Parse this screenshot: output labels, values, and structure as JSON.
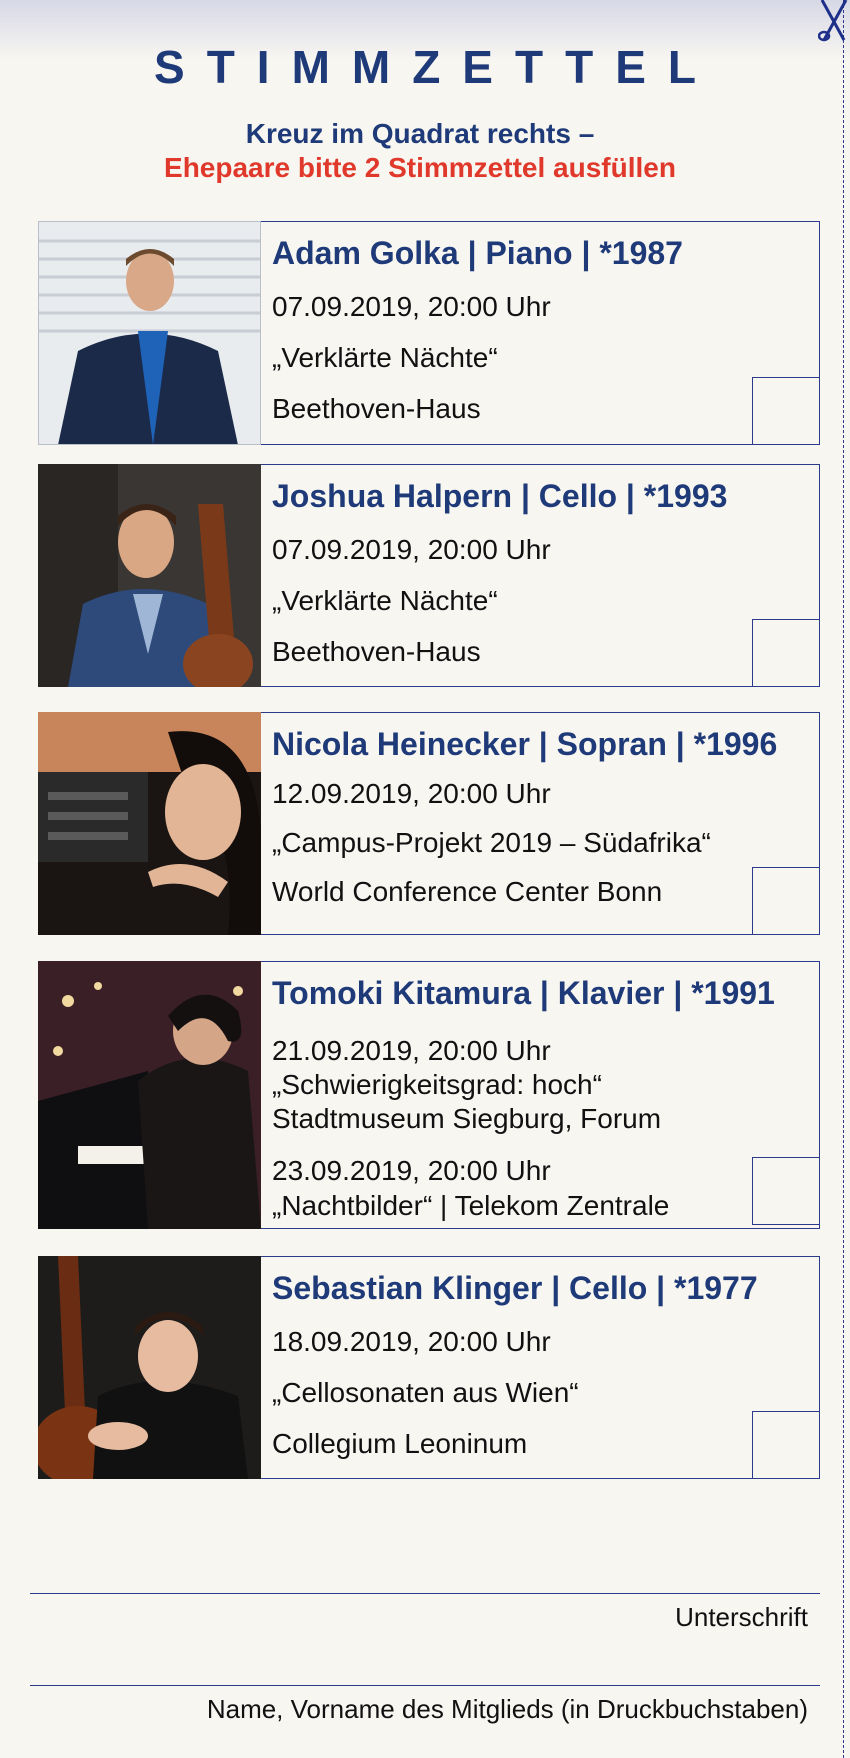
{
  "title": "STIMMZETTEL",
  "subtitle_line1": "Kreuz im Quadrat rechts –",
  "subtitle_line2": "Ehepaare bitte 2 Stimmzettel ausfüllen",
  "colors": {
    "navy": "#1e3a78",
    "red": "#e0392b",
    "paper": "#f8f6f1",
    "border": "#2b3a8c"
  },
  "entries": [
    {
      "name": "Adam Golka | Piano |  *1987",
      "lines": [
        "07.09.2019, 20:00 Uhr",
        "„Verklärte Nächte“",
        "Beethoven-Haus"
      ],
      "photo": "adam-golka-portrait"
    },
    {
      "name": "Joshua Halpern | Cello |  *1993",
      "lines": [
        "07.09.2019, 20:00 Uhr",
        "„Verklärte Nächte“",
        "Beethoven-Haus"
      ],
      "photo": "joshua-halpern-portrait"
    },
    {
      "name": "Nicola Heinecker | Sopran |  *1996",
      "lines": [
        "12.09.2019, 20:00 Uhr",
        "„Campus-Projekt 2019 – Südafrika“",
        "World Conference Center Bonn"
      ],
      "photo": "nicola-heinecker-portrait"
    },
    {
      "name": "Tomoki Kitamura | Klavier | *1991",
      "lines": [
        "21.09.2019, 20:00 Uhr",
        "„Schwierigkeitsgrad: hoch“",
        "Stadtmuseum Siegburg, Forum",
        "23.09.2019, 20:00 Uhr",
        "„Nachtbilder“ | Telekom Zentrale"
      ],
      "photo": "tomoki-kitamura-portrait"
    },
    {
      "name": "Sebastian Klinger | Cello |  *1977",
      "lines": [
        "18.09.2019, 20:00 Uhr",
        "„Cellosonaten aus Wien“",
        "Collegium Leoninum"
      ],
      "photo": "sebastian-klinger-portrait"
    }
  ],
  "signature_label": "Unterschrift",
  "name_label": "Name, Vorname des Mitglieds (in Druckbuchstaben)"
}
